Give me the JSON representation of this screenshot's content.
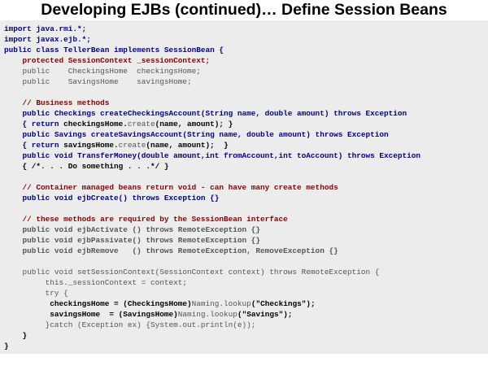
{
  "title": "Developing EJBs (continued)… Define Session Beans",
  "colors": {
    "keyword": "#00008b",
    "comment": "#8b0000",
    "plain": "#000000",
    "muted": "#555555",
    "panel_background": "#ececec"
  },
  "code_lines": [
    [
      {
        "t": "import java.rmi.*;",
        "c": "kw"
      }
    ],
    [
      {
        "t": "import javax.ejb.*;",
        "c": "kw"
      }
    ],
    [
      {
        "t": "public class TellerBean implements SessionBean {",
        "c": "kw"
      }
    ],
    [
      {
        "t": "    protected SessionContext _sessionContext;",
        "c": "red"
      }
    ],
    [
      {
        "t": "    public    CheckingsHome  checkingsHome;",
        "c": "gray"
      }
    ],
    [
      {
        "t": "    public    SavingsHome    savingsHome;",
        "c": "gray"
      }
    ],
    [],
    [
      {
        "t": "    // Business methods",
        "c": "red"
      }
    ],
    [
      {
        "t": "    public Checkings createCheckingsAccount(String name, double amount) throws Exception",
        "c": "kw"
      }
    ],
    [
      {
        "t": "    { return ",
        "c": "kw"
      },
      {
        "t": "checkingsHome.",
        "c": "plain"
      },
      {
        "t": "create",
        "c": "gray"
      },
      {
        "t": "(name, amount); }",
        "c": "plain"
      }
    ],
    [
      {
        "t": "    public Savings createSavingsAccount(String name, double amount) throws Exception",
        "c": "kw"
      }
    ],
    [
      {
        "t": "    { return ",
        "c": "kw"
      },
      {
        "t": "savingsHome.",
        "c": "plain"
      },
      {
        "t": "create",
        "c": "gray"
      },
      {
        "t": "(name, amount);  }",
        "c": "plain"
      }
    ],
    [
      {
        "t": "    public void TransferMoney(double amount,int fromAccount,int toAccount) throws Exception",
        "c": "kw"
      }
    ],
    [
      {
        "t": "    { /*. . . Do something . . .*/ }",
        "c": "plain"
      }
    ],
    [],
    [
      {
        "t": "    // Container managed beans return void - can have many create methods",
        "c": "red"
      }
    ],
    [
      {
        "t": "    public void ejbCreate() throws Exception {}",
        "c": "kw"
      }
    ],
    [],
    [
      {
        "t": "    // these methods are required by the SessionBean interface",
        "c": "red"
      }
    ],
    [
      {
        "t": "    public void ejbActivate () throws RemoteException {}",
        "c": "graybold"
      }
    ],
    [
      {
        "t": "    public void ejbPassivate() throws RemoteException {}",
        "c": "graybold"
      }
    ],
    [
      {
        "t": "    public void ejbRemove   () throws RemoteException, RemoveException {}",
        "c": "graybold"
      }
    ],
    [],
    [
      {
        "t": "    public void setSessionContext(SessionContext context) throws RemoteException {",
        "c": "gray"
      }
    ],
    [
      {
        "t": "         this._sessionContext = context;",
        "c": "gray"
      }
    ],
    [
      {
        "t": "         try {",
        "c": "gray"
      }
    ],
    [
      {
        "t": "          checkingsHome = (CheckingsHome)",
        "c": "plain"
      },
      {
        "t": "Naming.lookup",
        "c": "gray"
      },
      {
        "t": "(\"Checkings\");",
        "c": "plain"
      }
    ],
    [
      {
        "t": "          savingsHome  = (SavingsHome)",
        "c": "plain"
      },
      {
        "t": "Naming.lookup",
        "c": "gray"
      },
      {
        "t": "(\"Savings\");",
        "c": "plain"
      }
    ],
    [
      {
        "t": "         }catch (Exception ex) {System.out.println(e));",
        "c": "gray"
      }
    ],
    [
      {
        "t": "    }",
        "c": "plain"
      }
    ],
    [
      {
        "t": "}",
        "c": "plain"
      }
    ]
  ]
}
